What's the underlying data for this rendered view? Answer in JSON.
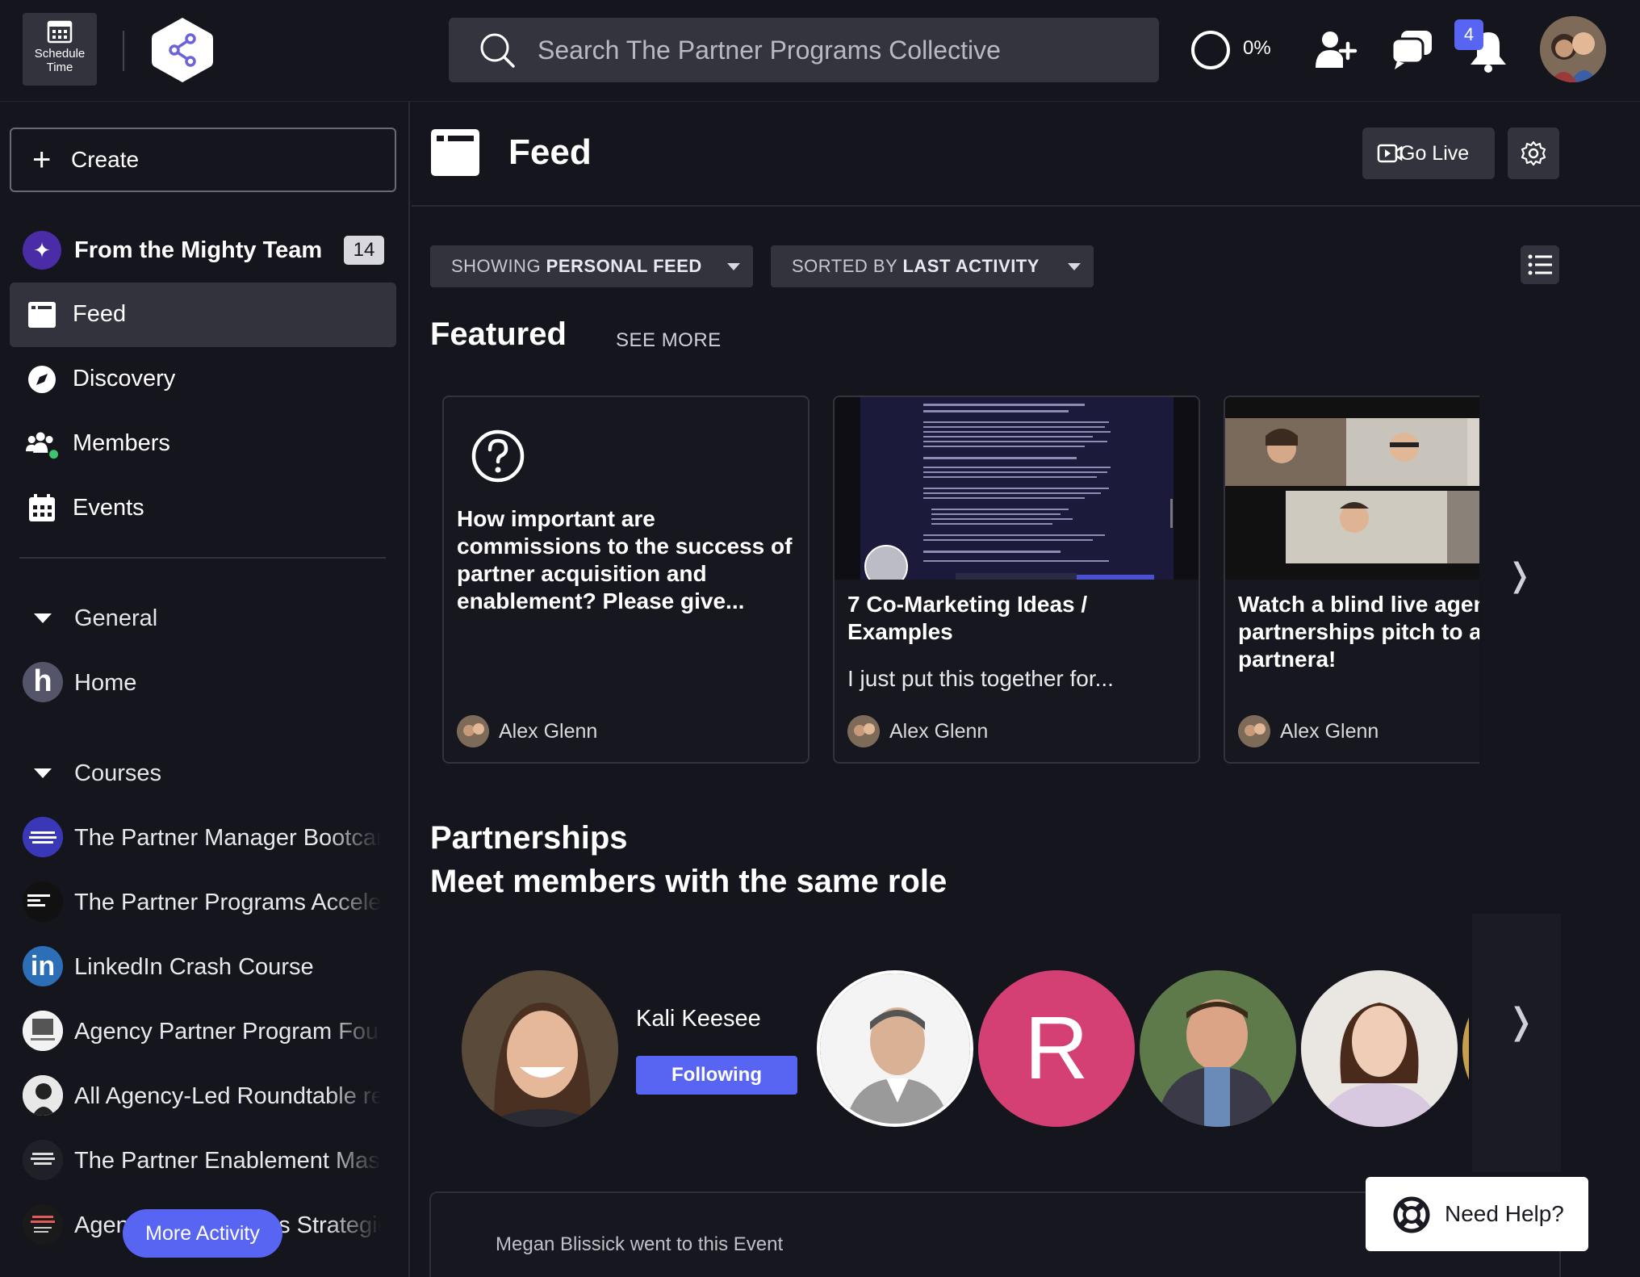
{
  "topbar": {
    "schedule_label": "Schedule Time",
    "search_placeholder": "Search The Partner Programs Collective",
    "progress_label": "0%",
    "progress_value": 0,
    "notifications_count": "4"
  },
  "sidebar": {
    "create_label": "Create",
    "mighty_label": "From the Mighty Team",
    "mighty_count": "14",
    "nav": [
      {
        "label": "Feed",
        "icon": "feed-icon"
      },
      {
        "label": "Discovery",
        "icon": "compass-icon"
      },
      {
        "label": "Members",
        "icon": "members-icon"
      },
      {
        "label": "Events",
        "icon": "calendar-icon"
      }
    ],
    "sections": {
      "general": "General",
      "courses": "Courses"
    },
    "general_items": [
      {
        "label": "Home",
        "avatar_letter": "h"
      }
    ],
    "courses": [
      {
        "label": "The Partner Manager Bootcamp"
      },
      {
        "label": "The Partner Programs Accelerator"
      },
      {
        "label": "LinkedIn Crash Course"
      },
      {
        "label": "Agency Partner Program Foundations"
      },
      {
        "label": "All Agency-Led Roundtable recordings"
      },
      {
        "label": "The Partner Enablement Masterclass"
      },
      {
        "label": "Agency Partnerships Strategies"
      }
    ],
    "more_activity": "More Activity"
  },
  "main": {
    "title": "Feed",
    "go_live": "Go Live",
    "filter_showing_prefix": "SHOWING ",
    "filter_showing_value": "PERSONAL FEED",
    "filter_sorted_prefix": "SORTED BY ",
    "filter_sorted_value": "LAST ACTIVITY",
    "featured_title": "Featured",
    "see_more": "SEE MORE",
    "featured_cards": [
      {
        "title": "How important are commissions to the success of partner acquisition and enablement? Please give...",
        "subtitle": "",
        "author": "Alex Glenn"
      },
      {
        "title": "7 Co-Marketing Ideas / Examples",
        "subtitle": "I just put this together for...",
        "author": "Alex Glenn"
      },
      {
        "title": "Watch a blind live agency partnerships pitch to a Klaviyo partnera!",
        "subtitle": "",
        "author": "Alex Glenn"
      }
    ],
    "partnerships_title": "Partnerships",
    "partnerships_subtitle": "Meet members with the same role",
    "members": [
      {
        "name": "Kali Keesee",
        "button": "Following"
      },
      {
        "name": ""
      },
      {
        "name": "",
        "initial": "R"
      },
      {
        "name": ""
      },
      {
        "name": ""
      }
    ],
    "activity_text": "Megan Blissick went to this Event",
    "need_help": "Need Help?"
  },
  "colors": {
    "accent": "#5865f2",
    "background": "#15151d",
    "surface": "#33333d",
    "avatar_r": "#d43f74"
  }
}
